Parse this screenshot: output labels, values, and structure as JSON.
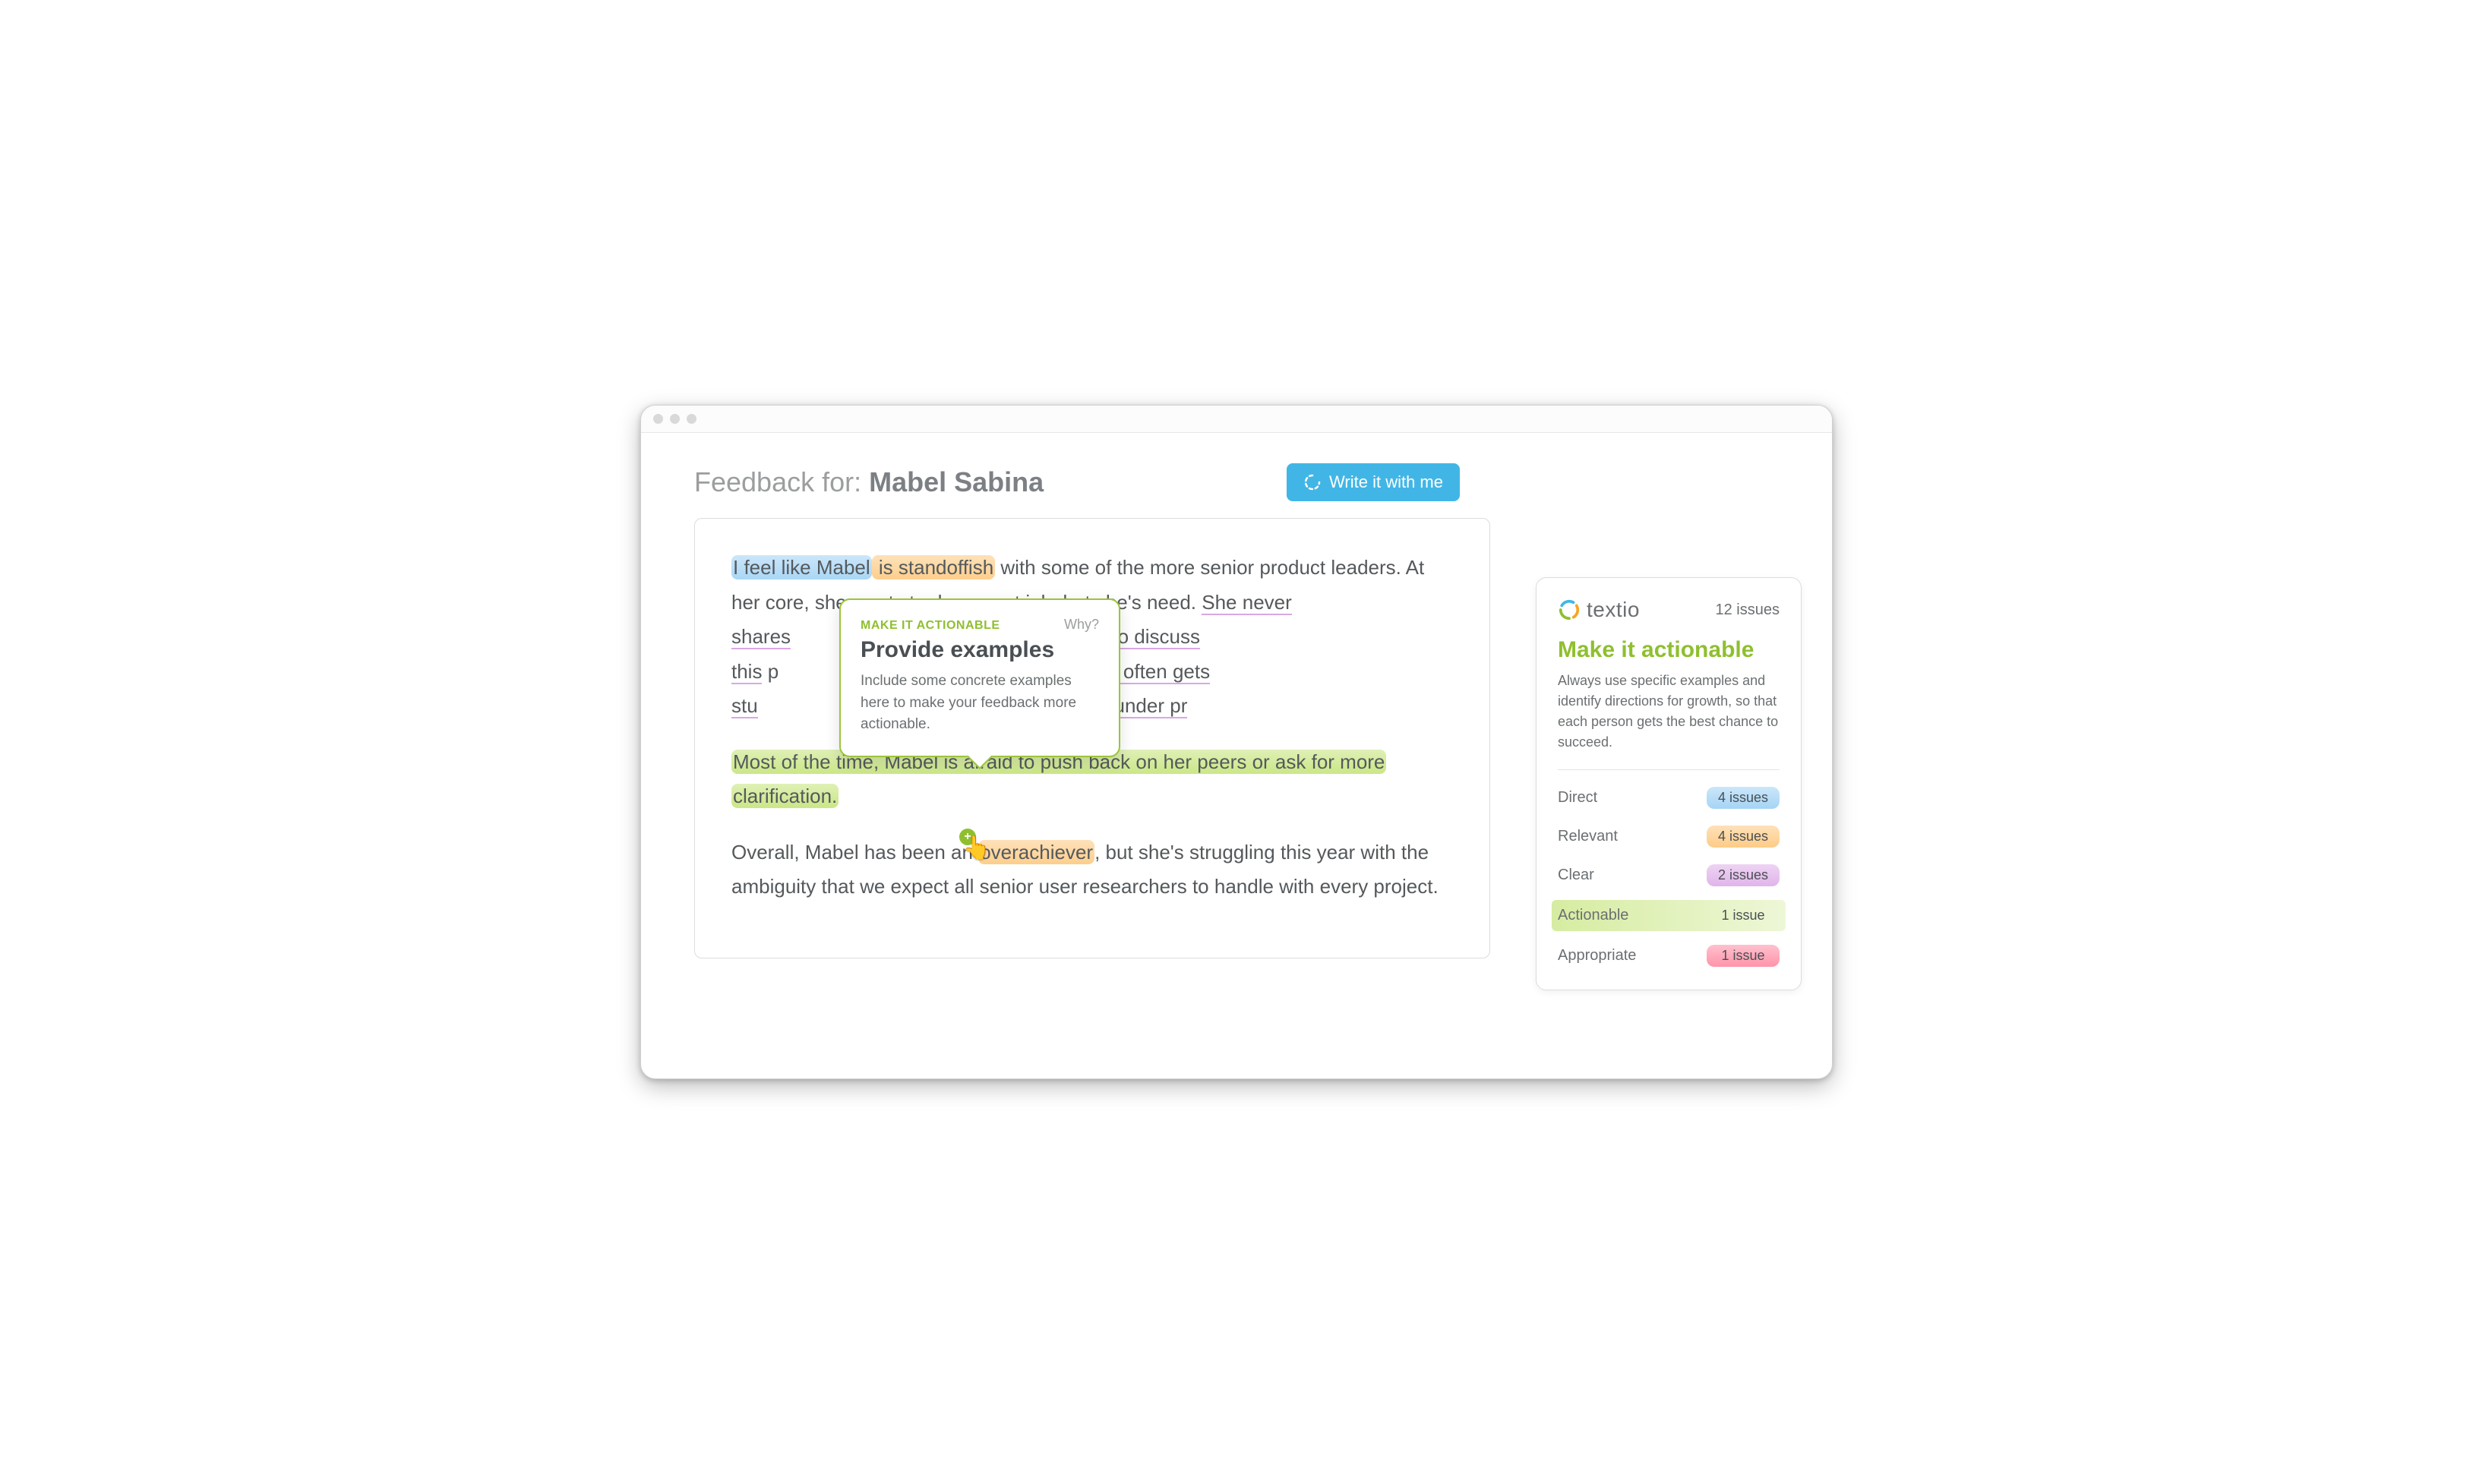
{
  "header": {
    "prefix": "Feedback for: ",
    "name": "Mabel Sabina",
    "write_button": "Write it with me"
  },
  "editor": {
    "p1": {
      "seg1": "I feel like Mabel",
      "seg2": " is standoffish",
      "seg3": " with some of the more senior product leaders. At her core, she wants to do a great job, but she's ",
      "seg4": "need. ",
      "seg5": "She never shares",
      "seg6": "hen I tried to discuss this",
      "seg7": "shared that she often gets stu",
      "seg8": "roceed when she's under pr"
    },
    "p2": "Most of the time, Mabel is afraid to push back on her peers or ask for more clarification.",
    "p3": {
      "a": "Overall, Mabel has been an ",
      "b": "overachiever",
      "c": ", but she's struggling this year with the ambiguity that we expect all senior user researchers to handle with every project."
    }
  },
  "popover": {
    "category": "MAKE IT ACTIONABLE",
    "why": "Why?",
    "title": "Provide examples",
    "body": "Include some concrete examples here to make your feedback more actionable."
  },
  "sidebar": {
    "brand": "textio",
    "total_issues": "12 issues",
    "title": "Make it actionable",
    "description": "Always use specific examples and identify directions for growth, so that each person gets the best chance to succeed.",
    "categories": [
      {
        "label": "Direct",
        "count": "4 issues"
      },
      {
        "label": "Relevant",
        "count": "4 issues"
      },
      {
        "label": "Clear",
        "count": "2 issues"
      },
      {
        "label": "Actionable",
        "count": "1 issue"
      },
      {
        "label": "Appropriate",
        "count": "1 issue"
      }
    ]
  }
}
